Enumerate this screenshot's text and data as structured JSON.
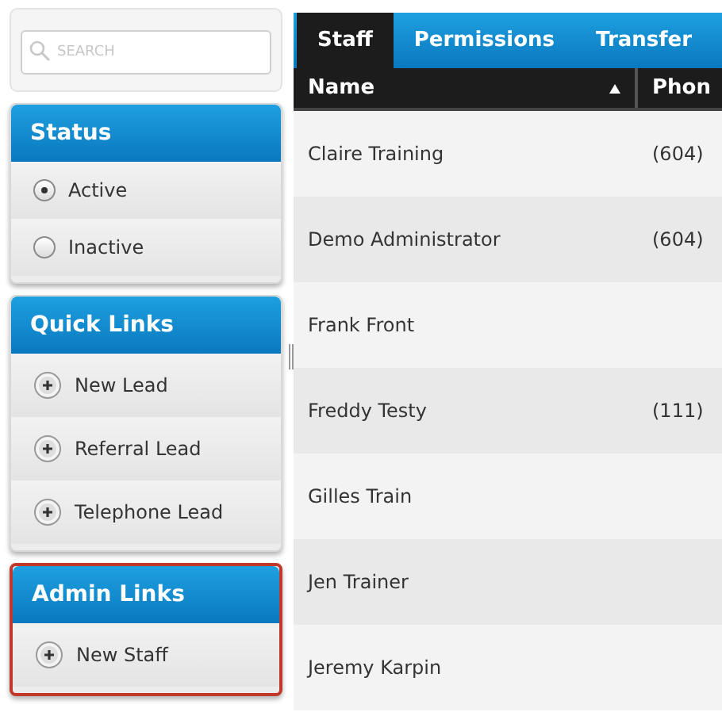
{
  "search": {
    "placeholder": "SEARCH"
  },
  "sidebar": {
    "sections": [
      {
        "title": "Status",
        "kind": "radio",
        "outlined": false,
        "items": [
          {
            "label": "Active",
            "selected": true
          },
          {
            "label": "Inactive",
            "selected": false
          }
        ]
      },
      {
        "title": "Quick Links",
        "kind": "link",
        "outlined": false,
        "items": [
          {
            "label": "New Lead"
          },
          {
            "label": "Referral Lead"
          },
          {
            "label": "Telephone Lead"
          }
        ]
      },
      {
        "title": "Admin Links",
        "kind": "link",
        "outlined": true,
        "items": [
          {
            "label": "New Staff"
          }
        ]
      }
    ]
  },
  "tabs": [
    {
      "label": "Staff",
      "selected": true
    },
    {
      "label": "Permissions",
      "selected": false
    },
    {
      "label": "Transfer",
      "selected": false
    }
  ],
  "table": {
    "columns": [
      {
        "label": "Name",
        "sorted": true
      },
      {
        "label": "Phon",
        "sorted": false
      }
    ],
    "rows": [
      {
        "name": "Claire Training",
        "phone": "(604)"
      },
      {
        "name": "Demo Administrator",
        "phone": "(604)"
      },
      {
        "name": "Frank Front",
        "phone": ""
      },
      {
        "name": "Freddy Testy",
        "phone": "(111)"
      },
      {
        "name": "Gilles Train",
        "phone": ""
      },
      {
        "name": "Jen Trainer",
        "phone": ""
      },
      {
        "name": "Jeremy Karpin",
        "phone": ""
      }
    ]
  }
}
